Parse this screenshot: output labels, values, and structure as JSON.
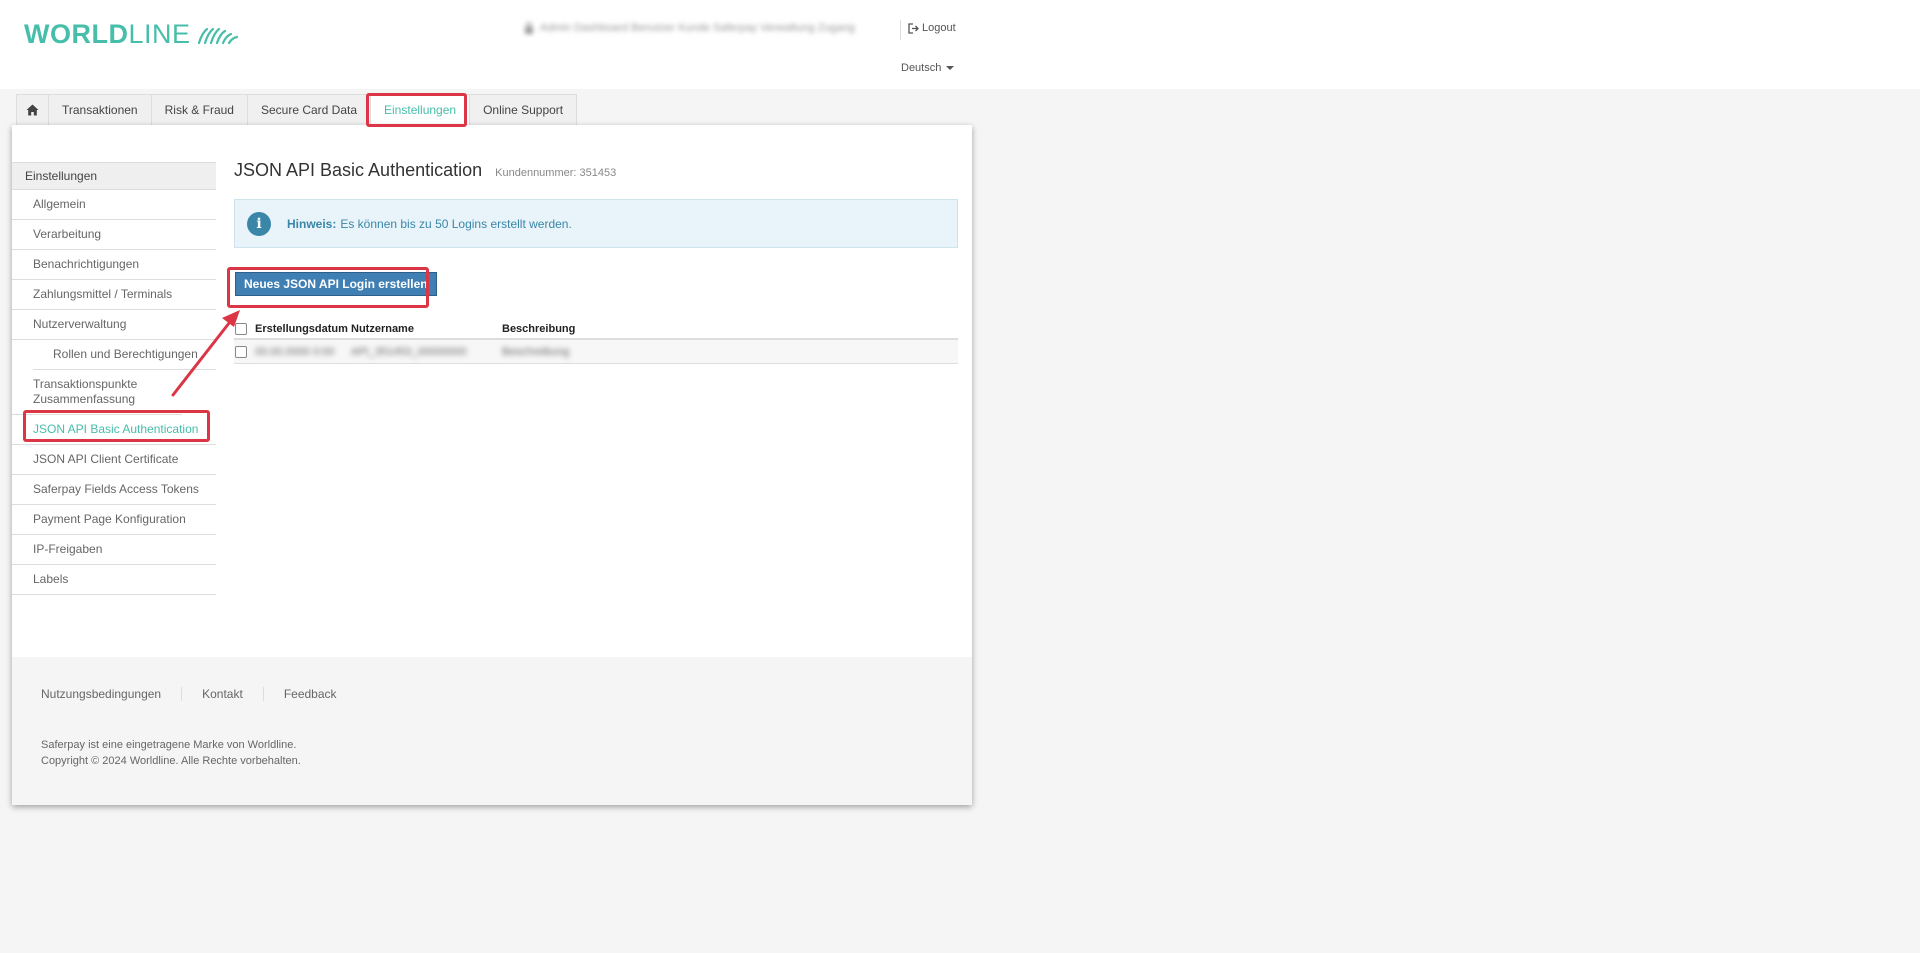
{
  "header": {
    "logo_bold": "WORLD",
    "logo_light": "LINE",
    "user_info_blurred": "Admin Dashboard Benutzer Kunde Saferpay Verwaltung Zugang",
    "logout_label": "Logout",
    "language": "Deutsch"
  },
  "nav": {
    "tabs": [
      {
        "label": "Transaktionen"
      },
      {
        "label": "Risk & Fraud"
      },
      {
        "label": "Secure Card Data"
      },
      {
        "label": "Einstellungen"
      },
      {
        "label": "Online Support"
      }
    ]
  },
  "sidebar": {
    "heading": "Einstellungen",
    "items": [
      {
        "label": "Allgemein"
      },
      {
        "label": "Verarbeitung"
      },
      {
        "label": "Benachrichtigungen"
      },
      {
        "label": "Zahlungsmittel / Terminals"
      },
      {
        "label": "Nutzerverwaltung"
      },
      {
        "label": "Rollen und Berechtigungen"
      },
      {
        "label": "Transaktionspunkte Zusammenfassung"
      },
      {
        "label": "JSON API Basic Authentication"
      },
      {
        "label": "JSON API Client Certificate"
      },
      {
        "label": "Saferpay Fields Access Tokens"
      },
      {
        "label": "Payment Page Konfiguration"
      },
      {
        "label": "IP-Freigaben"
      },
      {
        "label": "Labels"
      }
    ]
  },
  "main": {
    "title": "JSON API Basic Authentication",
    "customer_number": "Kundennummer: 351453",
    "alert_bold": "Hinweis:",
    "alert_text": "Es können bis zu 50 Logins erstellt werden.",
    "create_button": "Neues JSON API Login erstellen",
    "table": {
      "headers": [
        "Erstellungsdatum",
        "Nutzername",
        "Beschreibung"
      ],
      "row_blurred": [
        "00.00.0000 0:00",
        "API_351453_00000000",
        "Beschreibung"
      ]
    }
  },
  "footer": {
    "links": [
      "Nutzungsbedingungen",
      "Kontakt",
      "Feedback"
    ],
    "trademark": "Saferpay ist eine eingetragene Marke von Worldline.",
    "copyright": "Copyright © 2024 Worldline. Alle Rechte vorbehalten."
  },
  "colors": {
    "brand": "#46beaa",
    "button": "#3f7fb3",
    "highlight": "#dc3545",
    "alert_text": "#3a86a8"
  },
  "icons": {
    "home": "home-icon",
    "logout": "logout-icon",
    "info": "info-icon",
    "lock": "lock-icon"
  }
}
